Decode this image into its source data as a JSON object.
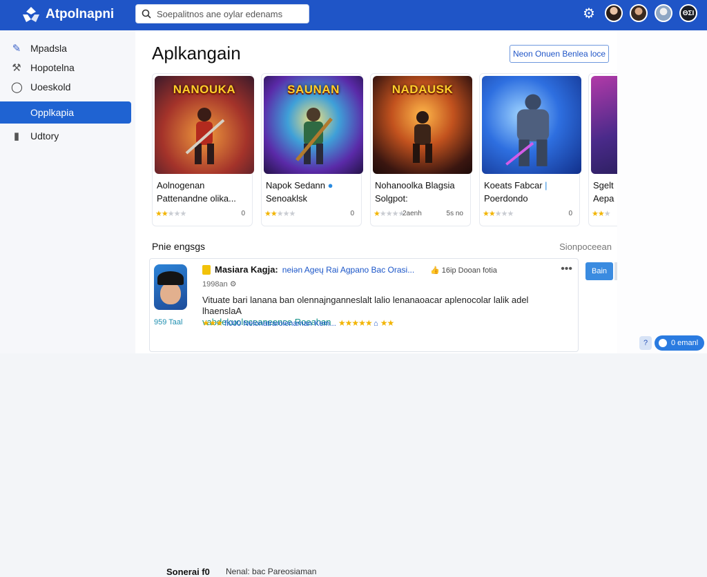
{
  "app": {
    "name": "Atpolnapni"
  },
  "search": {
    "placeholder": "Soepalitnos ane oylar edenams"
  },
  "topbar": {
    "icons": [
      "gear-icon",
      "avatar",
      "avatar",
      "avatar",
      "avatar"
    ],
    "avatar_badge": "ΘΣΙ"
  },
  "sidebar": {
    "items": [
      {
        "label": "Mpadsla",
        "icon": "pen-icon",
        "active": false
      },
      {
        "label": "Hopotelna",
        "icon": "hammer-icon",
        "active": false
      },
      {
        "label": "Uoeskold",
        "icon": "circle-icon",
        "active": false
      },
      {
        "label": "Opplkapia",
        "icon": "none",
        "active": true
      },
      {
        "label": "Udtory",
        "icon": "trash-icon",
        "active": false
      }
    ]
  },
  "main": {
    "title": "Aplkangain",
    "top_button": "Neon Onuen Benlea loce"
  },
  "cards": [
    {
      "art_title": "NANOUKA",
      "name1": "Aolnogenan",
      "name2": "Pattenandne olika...",
      "rating": 2,
      "meta": "",
      "count": "0"
    },
    {
      "art_title": "SAUNAN",
      "name1": "Napok Sedann",
      "name2": "Senoaklsk",
      "rating": 2,
      "meta": "",
      "count": "0"
    },
    {
      "art_title": "NADAUSK",
      "name1": "Nohanoolka Blagsia",
      "name2": "Solgpot:",
      "rating": 1,
      "meta": "2aenh",
      "count": "5s no"
    },
    {
      "art_title": "",
      "name1": "Koeats Fabcar",
      "name2": "Poerdondo",
      "rating": 2,
      "meta": "",
      "count": "0"
    },
    {
      "art_title": "",
      "name1": "Sgelt",
      "name2": "Aepa",
      "rating": 2,
      "meta": "",
      "count": ""
    }
  ],
  "reviews_section": {
    "title": "Pnie engsgs",
    "link": "Sionpoceean",
    "review": {
      "author": "Masiara Kagja:",
      "tags": "neiən Ageų  Rai   Agpano  Bac  Orasi...",
      "right": "16ip  Dooan fotia",
      "date": "1998an",
      "body": "Vituate bari lanana ban olennajnganneslalt lalio lenanaoacar aplenocolar lalik adel lhaenslaA",
      "highlight": "vabdekuoleceaneence Roeahan",
      "rating_value": "959  Taal",
      "foot_text": "fi000  Nelonatraroienaman Kem...",
      "more": "•••"
    },
    "side_button": "Bain",
    "sub_left": "Sonerai f0",
    "sub_right": "Nenal: bac  Pareosiaman"
  },
  "chat": {
    "label": "0 emanl",
    "help": "?"
  },
  "colors": {
    "topbar": "#1f55c7",
    "active": "#1f63d2",
    "star": "#f2b400"
  }
}
